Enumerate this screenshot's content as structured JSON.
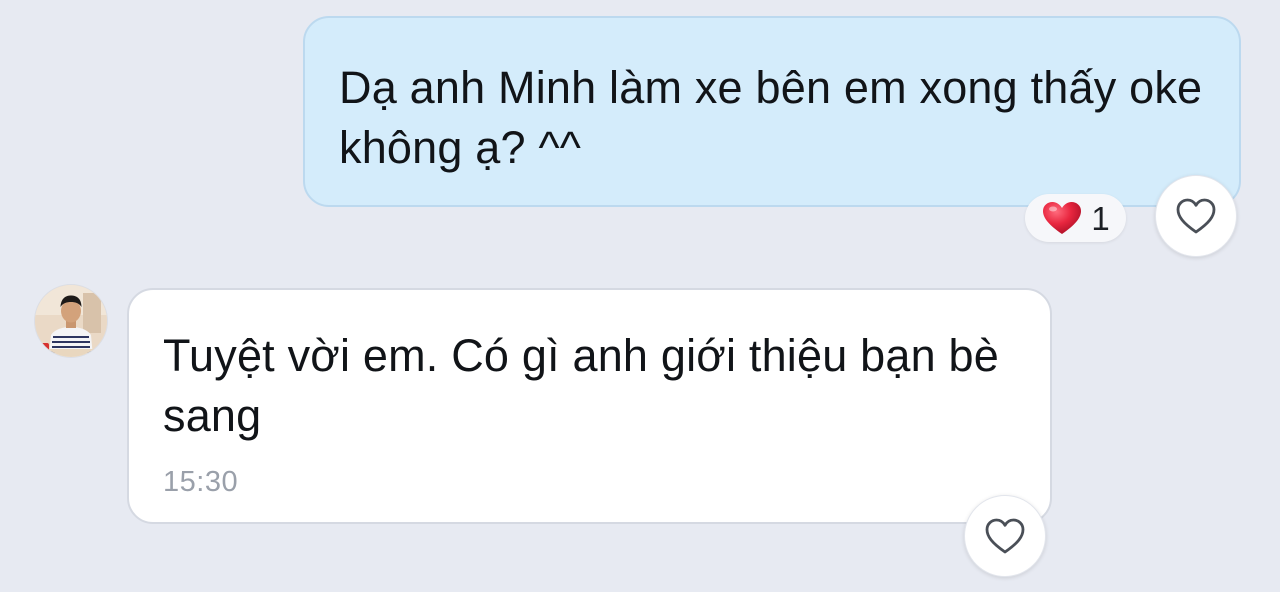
{
  "messages": [
    {
      "direction": "outgoing",
      "text": "Dạ anh Minh làm xe bên em xong thấy oke không ạ? ^^",
      "reaction": {
        "icon": "heart-icon",
        "count": "1"
      },
      "bubble_color": "#d4ecfb"
    },
    {
      "direction": "incoming",
      "avatar": "avatar",
      "text": "Tuyệt vời em. Có gì anh giới thiệu bạn bè sang",
      "time": "15:30",
      "bubble_color": "#ffffff"
    }
  ],
  "icons": {
    "like": "heart-outline-icon",
    "reaction": "heart-icon"
  },
  "colors": {
    "background": "#e7eaf2",
    "reaction_heart": "#e6213b",
    "timestamp": "#9aa0aa"
  }
}
